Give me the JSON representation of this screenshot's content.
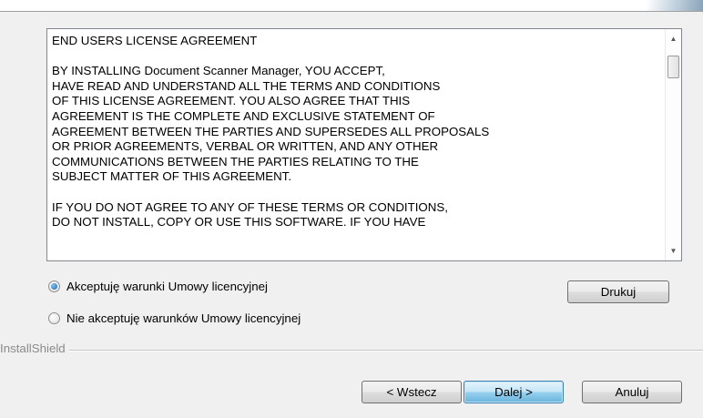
{
  "license": {
    "text": "END USERS LICENSE AGREEMENT\n\nBY INSTALLING Document Scanner Manager, YOU ACCEPT,\nHAVE READ AND UNDERSTAND ALL THE TERMS AND CONDITIONS\nOF THIS LICENSE AGREEMENT. YOU ALSO AGREE THAT THIS\nAGREEMENT IS THE COMPLETE AND EXCLUSIVE STATEMENT OF\nAGREEMENT BETWEEN THE PARTIES AND SUPERSEDES ALL PROPOSALS\nOR PRIOR AGREEMENTS, VERBAL OR WRITTEN, AND ANY OTHER\nCOMMUNICATIONS BETWEEN THE PARTIES RELATING TO THE\nSUBJECT MATTER OF THIS AGREEMENT.\n\nIF YOU DO NOT AGREE TO ANY OF THESE TERMS OR CONDITIONS,\nDO NOT INSTALL, COPY OR USE THIS SOFTWARE. IF YOU HAVE"
  },
  "options": {
    "accept_label": "Akceptuję warunki Umowy licencyjnej",
    "decline_label": "Nie akceptuję warunków Umowy licencyjnej",
    "selected": "accept"
  },
  "buttons": {
    "print_label": "Drukuj",
    "back_label": "< Wstecz",
    "next_label": "Dalej >",
    "cancel_label": "Anuluj"
  },
  "footer": {
    "brand": "InstallShield"
  },
  "icons": {
    "scroll_up": "scroll-up-arrow-icon",
    "scroll_down": "scroll-down-arrow-icon"
  }
}
